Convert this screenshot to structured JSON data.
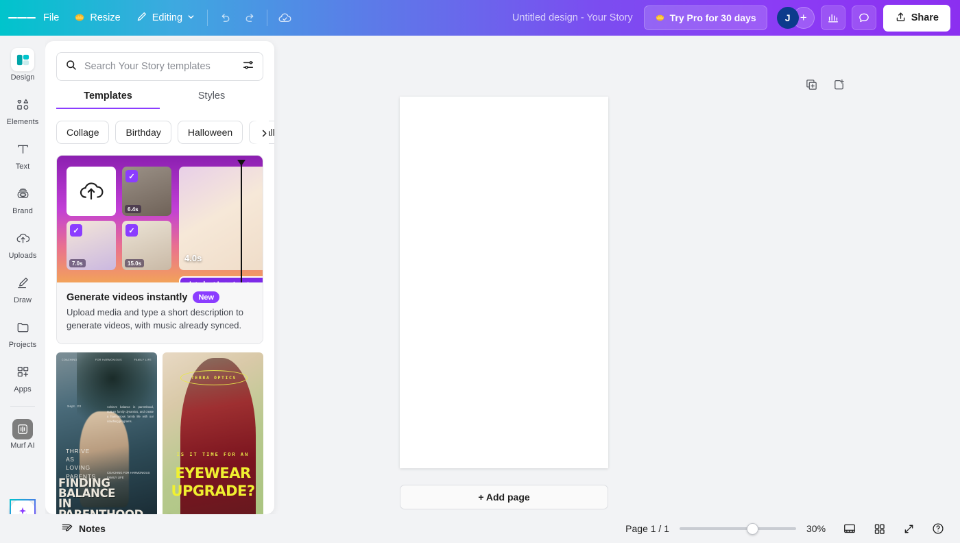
{
  "topbar": {
    "menu_icon": "hamburger-icon",
    "file_label": "File",
    "resize_label": "Resize",
    "resize_icon": "crown-icon",
    "editing_label": "Editing",
    "editing_icon": "pencil-icon",
    "undo_icon": "undo-icon",
    "redo_icon": "redo-icon",
    "cloud_icon": "cloud-saved-icon",
    "doc_title": "Untitled design - Your Story",
    "try_pro_label": "Try Pro for 30 days",
    "try_pro_icon": "crown-icon",
    "avatar_initial": "J",
    "add_member_icon": "plus-icon",
    "insights_icon": "bar-chart-icon",
    "comment_icon": "comment-icon",
    "share_label": "Share",
    "share_icon": "upload-icon"
  },
  "sidebar": {
    "items": [
      {
        "label": "Design",
        "icon": "design-icon",
        "active": true
      },
      {
        "label": "Elements",
        "icon": "elements-icon",
        "active": false
      },
      {
        "label": "Text",
        "icon": "text-icon",
        "active": false
      },
      {
        "label": "Brand",
        "icon": "brand-icon",
        "active": false
      },
      {
        "label": "Uploads",
        "icon": "uploads-icon",
        "active": false
      },
      {
        "label": "Draw",
        "icon": "draw-icon",
        "active": false
      },
      {
        "label": "Projects",
        "icon": "projects-icon",
        "active": false
      },
      {
        "label": "Apps",
        "icon": "apps-icon",
        "active": false
      },
      {
        "label": "Murf AI",
        "icon": "murf-ai-icon",
        "active": false
      }
    ],
    "magic_button_icon": "sparkle-icon"
  },
  "panel": {
    "search": {
      "placeholder": "Search Your Story templates",
      "value": "",
      "search_icon": "search-icon",
      "filter_icon": "filter-sliders-icon"
    },
    "tabs": [
      {
        "label": "Templates",
        "active": true
      },
      {
        "label": "Styles",
        "active": false
      }
    ],
    "chips": [
      "Collage",
      "Birthday",
      "Halloween",
      "Fall"
    ],
    "chip_next_icon": "chevron-right-icon",
    "promo": {
      "title": "Generate videos instantly",
      "badge": "New",
      "description": "Upload media and type a short description to generate videos, with music already synced.",
      "upload_icon": "cloud-upload-icon",
      "clips": [
        {
          "duration": "6.4s",
          "checked": true
        },
        {
          "duration": "7.0s",
          "checked": true
        },
        {
          "duration": "15.0s",
          "checked": true
        }
      ],
      "preview_duration": "4.0s",
      "check_glyph": "✓"
    },
    "templates": [
      {
        "name": "finding-balance-template",
        "tiny_labels": [
          "COACHING",
          "FOR HARMONIOUS",
          "FAMILY LIFE"
        ],
        "date_label": "Sept. 23",
        "paragraph": "Achieve balance in parenthood, nurture family dynamics, and create a harmonious family life with our coaching programs.",
        "small_label": "COACHING FOR HARMONIOUS FAMILY LIFE",
        "mid_text": "THRIVE\nAS\nLOVING\nPARENTS",
        "headline_1": "FINDING  BALANCE",
        "headline_2": "IN PARENTHOOD",
        "play_icon": "play-icon"
      },
      {
        "name": "eyewear-upgrade-template",
        "logo": "TERRA OPTICS",
        "subtitle": "IS IT TIME FOR AN",
        "headline_1": "EYEWEAR",
        "headline_2": "UPGRADE?",
        "play_icon": "play-icon",
        "mute_icon": "mute-icon"
      }
    ]
  },
  "canvas": {
    "duplicate_page_icon": "duplicate-page-icon",
    "add_page_icon": "add-page-icon",
    "add_page_label": "+ Add page"
  },
  "bottombar": {
    "notes_label": "Notes",
    "notes_icon": "notes-icon",
    "page_count": "Page 1 / 1",
    "zoom_value": "30%",
    "zoom_percent": 30,
    "notes_view_icon": "presenter-view-icon",
    "grid_view_icon": "grid-view-icon",
    "fullscreen_icon": "fullscreen-icon",
    "help_icon": "help-icon"
  },
  "colors": {
    "accent_purple": "#8b3dff",
    "brand_teal": "#00c4cc",
    "avatar_navy": "#0c3b8c"
  }
}
